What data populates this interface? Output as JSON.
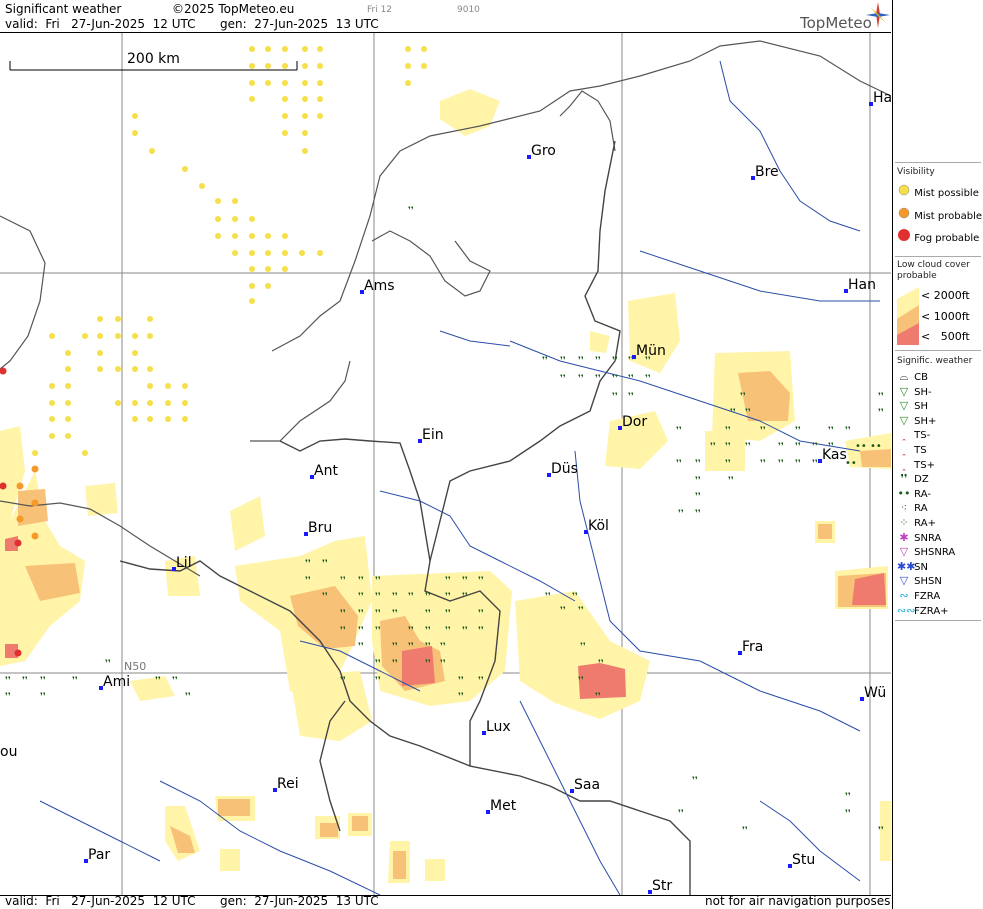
{
  "header": {
    "title": "Significant weather",
    "copyright": "©2025 TopMeteo.eu",
    "small1": "Fri 12",
    "small2": "9010",
    "valid": "valid:  Fri   27-Jun-2025  12 UTC",
    "gen": "gen:  27-Jun-2025  13 UTC",
    "logo": "TopMeteo"
  },
  "footer": {
    "valid": "valid:  Fri   27-Jun-2025  12 UTC",
    "gen": "gen:  27-Jun-2025  13 UTC",
    "note": "not for air navigation purposes"
  },
  "map": {
    "scale_label": "200 km",
    "lat_label": "N50",
    "cities": [
      "Gro",
      "Bre",
      "Ha",
      "Ams",
      "Han",
      "Mün",
      "Dor",
      "Ein",
      "Kas",
      "Ant",
      "Düs",
      "Köl",
      "Bru",
      "Lil",
      "Fra",
      "Ami",
      "Lux",
      "Wü",
      "ou",
      "Rei",
      "Saa",
      "Met",
      "Stu",
      "Par",
      "Str"
    ]
  },
  "legend": {
    "visibility_title": "Visibility",
    "visibility": [
      {
        "label": "Mist possible",
        "color": "#f5e04a"
      },
      {
        "label": "Mist probable",
        "color": "#f59a2a"
      },
      {
        "label": "Fog probable",
        "color": "#e03030"
      }
    ],
    "lowcloud_title": "Low cloud cover probable",
    "lowcloud": [
      "< 2000ft",
      "< 1000ft",
      "<   500ft"
    ],
    "sigwx_title": "Signific. weather",
    "sigwx": [
      {
        "label": "CB",
        "icon": "cb-icon",
        "sym": "⌓",
        "color": "#333"
      },
      {
        "label": "SH-",
        "icon": "shower-light-icon",
        "sym": "▽",
        "color": "#2a8a2a"
      },
      {
        "label": "SH",
        "icon": "shower-icon",
        "sym": "▽",
        "color": "#2a8a2a"
      },
      {
        "label": "SH+",
        "icon": "shower-heavy-icon",
        "sym": "▽",
        "color": "#2a8a2a"
      },
      {
        "label": "TS-",
        "icon": "thunder-light-icon",
        "sym": "ꞈ",
        "color": "#d23030"
      },
      {
        "label": "TS",
        "icon": "thunder-icon",
        "sym": "ꞈ",
        "color": "#d23030"
      },
      {
        "label": "TS+",
        "icon": "thunder-heavy-icon",
        "sym": "ꞈ",
        "color": "#d23030"
      },
      {
        "label": "DZ",
        "icon": "drizzle-icon",
        "sym": "❜❜",
        "color": "#1a5a1a"
      },
      {
        "label": "RA-",
        "icon": "rain-light-icon",
        "sym": "••",
        "color": "#1a5a1a"
      },
      {
        "label": "RA",
        "icon": "rain-icon",
        "sym": "⁖",
        "color": "#1a5a1a"
      },
      {
        "label": "RA+",
        "icon": "rain-heavy-icon",
        "sym": "⁘",
        "color": "#1a5a1a"
      },
      {
        "label": "SNRA",
        "icon": "snow-rain-icon",
        "sym": "✱",
        "color": "#c040c0"
      },
      {
        "label": "SHSNRA",
        "icon": "snow-rain-shower-icon",
        "sym": "▽",
        "color": "#c040c0"
      },
      {
        "label": "SN",
        "icon": "snow-icon",
        "sym": "✱✱",
        "color": "#2a4ad0"
      },
      {
        "label": "SHSN",
        "icon": "snow-shower-icon",
        "sym": "▽",
        "color": "#2a4ad0"
      },
      {
        "label": "FZRA",
        "icon": "freezing-rain-icon",
        "sym": "∾",
        "color": "#20b0d0"
      },
      {
        "label": "FZRA+",
        "icon": "freezing-rain-heavy-icon",
        "sym": "∾∾",
        "color": "#20b0d0"
      }
    ]
  }
}
